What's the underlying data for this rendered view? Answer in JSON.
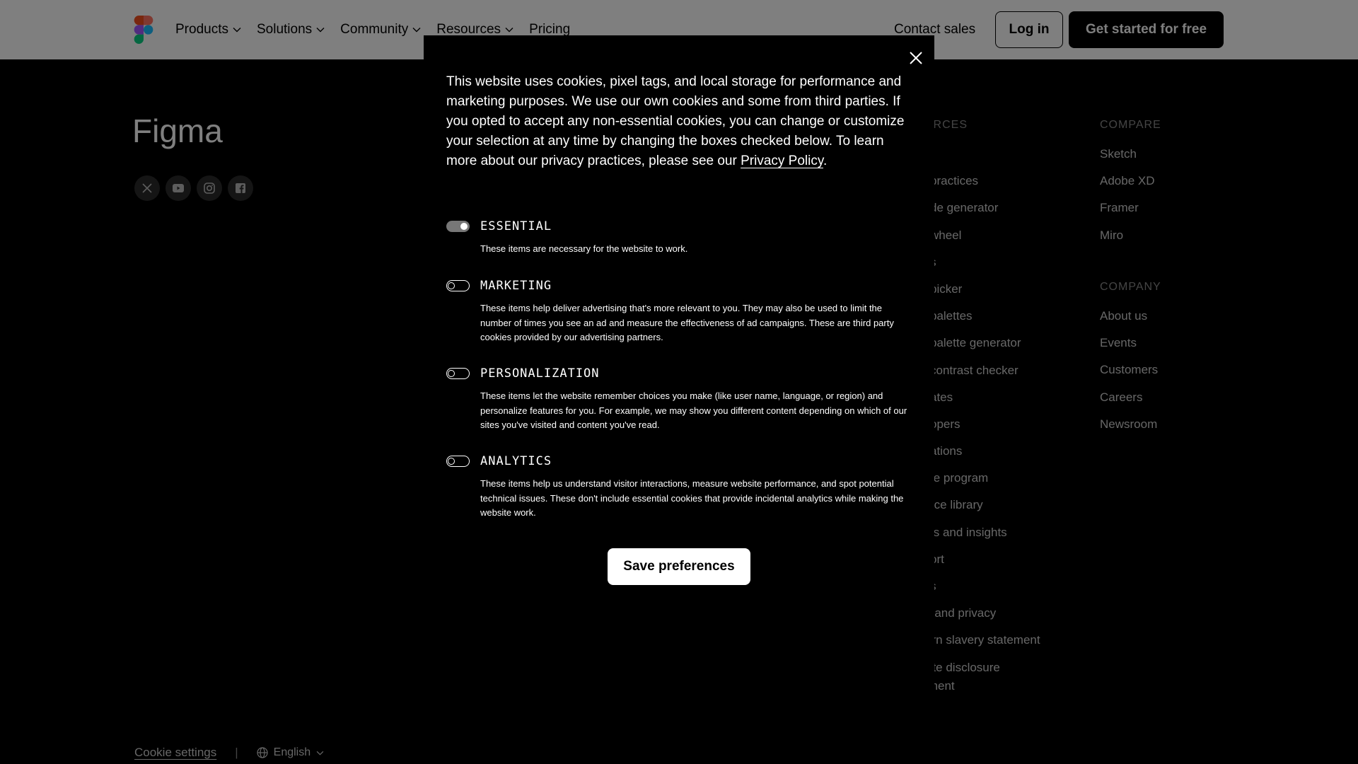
{
  "header": {
    "nav": [
      {
        "label": "Products"
      },
      {
        "label": "Solutions"
      },
      {
        "label": "Community"
      },
      {
        "label": "Resources"
      },
      {
        "label": "Pricing"
      }
    ],
    "contact": "Contact sales",
    "login": "Log in",
    "cta": "Get started for free"
  },
  "footer": {
    "brand": "Figma",
    "socials": [
      "x-icon",
      "youtube-icon",
      "instagram-icon",
      "facebook-icon"
    ],
    "resources": {
      "heading": "URCES",
      "items": [
        "",
        "practices",
        "de generator",
        "wheel",
        "s",
        "picker",
        "palettes",
        "palette generator",
        "contrast checker",
        "ates",
        "opers",
        "ations",
        "te program",
        "rce library",
        "ts and insights",
        "ort",
        "s",
        "Legal and privacy",
        "Modern slavery statement",
        "Climate disclosure"
      ],
      "wrapped_tail": "statement"
    },
    "compare": {
      "heading": "COMPARE",
      "items": [
        "Sketch",
        "Adobe XD",
        "Framer",
        "Miro"
      ]
    },
    "company": {
      "heading": "COMPANY",
      "items": [
        "About us",
        "Events",
        "Customers",
        "Careers",
        "Newsroom"
      ]
    },
    "bottom": {
      "cookie_settings": "Cookie settings",
      "separator": "|",
      "language": "English"
    }
  },
  "modal": {
    "intro": "This website uses cookies, pixel tags, and local storage for performance and marketing purposes. We use our own cookies and some from third parties. If you opted to accept any non-essential cookies, you can change or customize your selection at any time by changing the boxes checked below. To learn more about our privacy practices, please see our ",
    "privacy_link": "Privacy Policy",
    "intro_end": ".",
    "prefs": [
      {
        "title": "ESSENTIAL",
        "desc": "These items are necessary for the website to work.",
        "enabled": true
      },
      {
        "title": "MARKETING",
        "desc": "These items help deliver advertising that's more relevant to you. They may also be used to limit the number of times you see an ad and measure the effectiveness of ad campaigns. These are third party cookies provided by our advertising partners.",
        "enabled": false
      },
      {
        "title": "PERSONALIZATION",
        "desc": "These items let the website remember choices you make (like user name, language, or region) and personalize features for you. For example, we may show you different content depending on which of our sites you've visited and content you've read.",
        "enabled": false
      },
      {
        "title": "ANALYTICS",
        "desc": "These items help us understand visitor interactions, measure website performance, and spot potential technical issues. These don't include essential cookies that provide incidental analytics while making the website work.",
        "enabled": false
      }
    ],
    "save": "Save preferences"
  },
  "colors": {
    "overlay": "rgba(0,0,0,0.5)",
    "logo": [
      "#f24e1e",
      "#ff7262",
      "#a259ff",
      "#1abcfe",
      "#0acf83"
    ]
  }
}
